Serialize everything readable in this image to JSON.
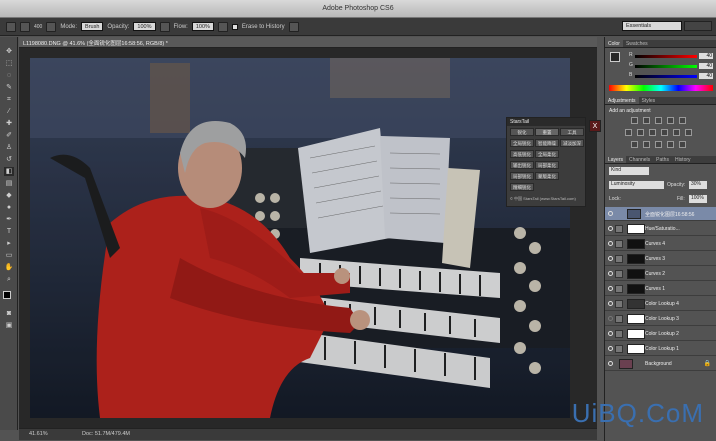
{
  "app": {
    "title": "Adobe Photoshop CS6"
  },
  "options": {
    "mode_label": "Mode:",
    "mode_value": "Brush",
    "opacity_label": "Opacity:",
    "opacity_value": "100%",
    "flow_label": "Flow:",
    "flow_value": "100%",
    "erase_label": "Erase to History",
    "brush_size": "400",
    "workspace": "Essentials"
  },
  "document": {
    "tab": "L1198080.DNG @ 41.6% (全面锐化图层16:58:56, RGB/8) *",
    "zoom": "41.61%",
    "doc_size": "Doc: 51.7M/479.4M"
  },
  "color_panel": {
    "tabs": [
      "Color",
      "Swatches"
    ],
    "r": "40",
    "g": "40",
    "b": "40",
    "r_label": "R",
    "g_label": "G",
    "b_label": "B"
  },
  "adjust_panel": {
    "tabs": [
      "Adjustments",
      "Styles"
    ],
    "heading": "Add an adjustment"
  },
  "layers_panel": {
    "tabs": [
      "Layers",
      "Channels",
      "Paths",
      "History"
    ],
    "kind": "Kind",
    "blend": "Luminosity",
    "opacity_label": "Opacity:",
    "opacity": "30%",
    "lock_label": "Lock:",
    "fill_label": "Fill:",
    "fill": "100%",
    "layers": [
      {
        "name": "全面锐化图层16:58:56"
      },
      {
        "name": "Hue/Saturatio..."
      },
      {
        "name": "Curves 4"
      },
      {
        "name": "Curves 3"
      },
      {
        "name": "Curves 2"
      },
      {
        "name": "Curves 1"
      },
      {
        "name": "Color Lookup 4"
      },
      {
        "name": "Color Lookup 3"
      },
      {
        "name": "Color Lookup 2"
      },
      {
        "name": "Color Lookup 1"
      },
      {
        "name": "Background"
      }
    ]
  },
  "starstail": {
    "title": "StarsTail",
    "buttons": [
      "锐化",
      "重置",
      "工具",
      "全局锐化",
      "智能降噪",
      "减淡加深",
      "高低锐化",
      "全局柔化",
      "输出锐化",
      "局部柔化",
      "局部锐化",
      "蒙版柔化",
      "精细锐化"
    ],
    "footer": "© 中国 StarsTail (www.StarsTail.com)"
  },
  "watermark": "UiBQ.CoM"
}
